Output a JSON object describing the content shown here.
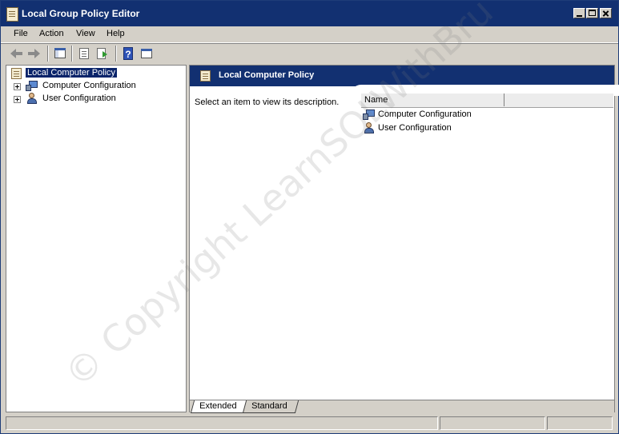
{
  "window": {
    "title": "Local Group Policy Editor"
  },
  "menu": {
    "items": [
      "File",
      "Action",
      "View",
      "Help"
    ]
  },
  "toolbar": {
    "icons": [
      "back-arrow-icon",
      "forward-arrow-icon",
      "show-hide-tree-icon",
      "properties-icon",
      "export-list-icon",
      "help-icon",
      "show-hide-action-pane-icon"
    ]
  },
  "tree": {
    "root": "Local Computer Policy",
    "children": [
      "Computer Configuration",
      "User Configuration"
    ]
  },
  "details": {
    "header_title": "Local Computer Policy",
    "description": "Select an item to view its description.",
    "column_name": "Name",
    "items": [
      "Computer Configuration",
      "User Configuration"
    ]
  },
  "tabs": {
    "extended": "Extended",
    "standard": "Standard"
  },
  "watermark": "© Copyright LearnSQLWithBru"
}
